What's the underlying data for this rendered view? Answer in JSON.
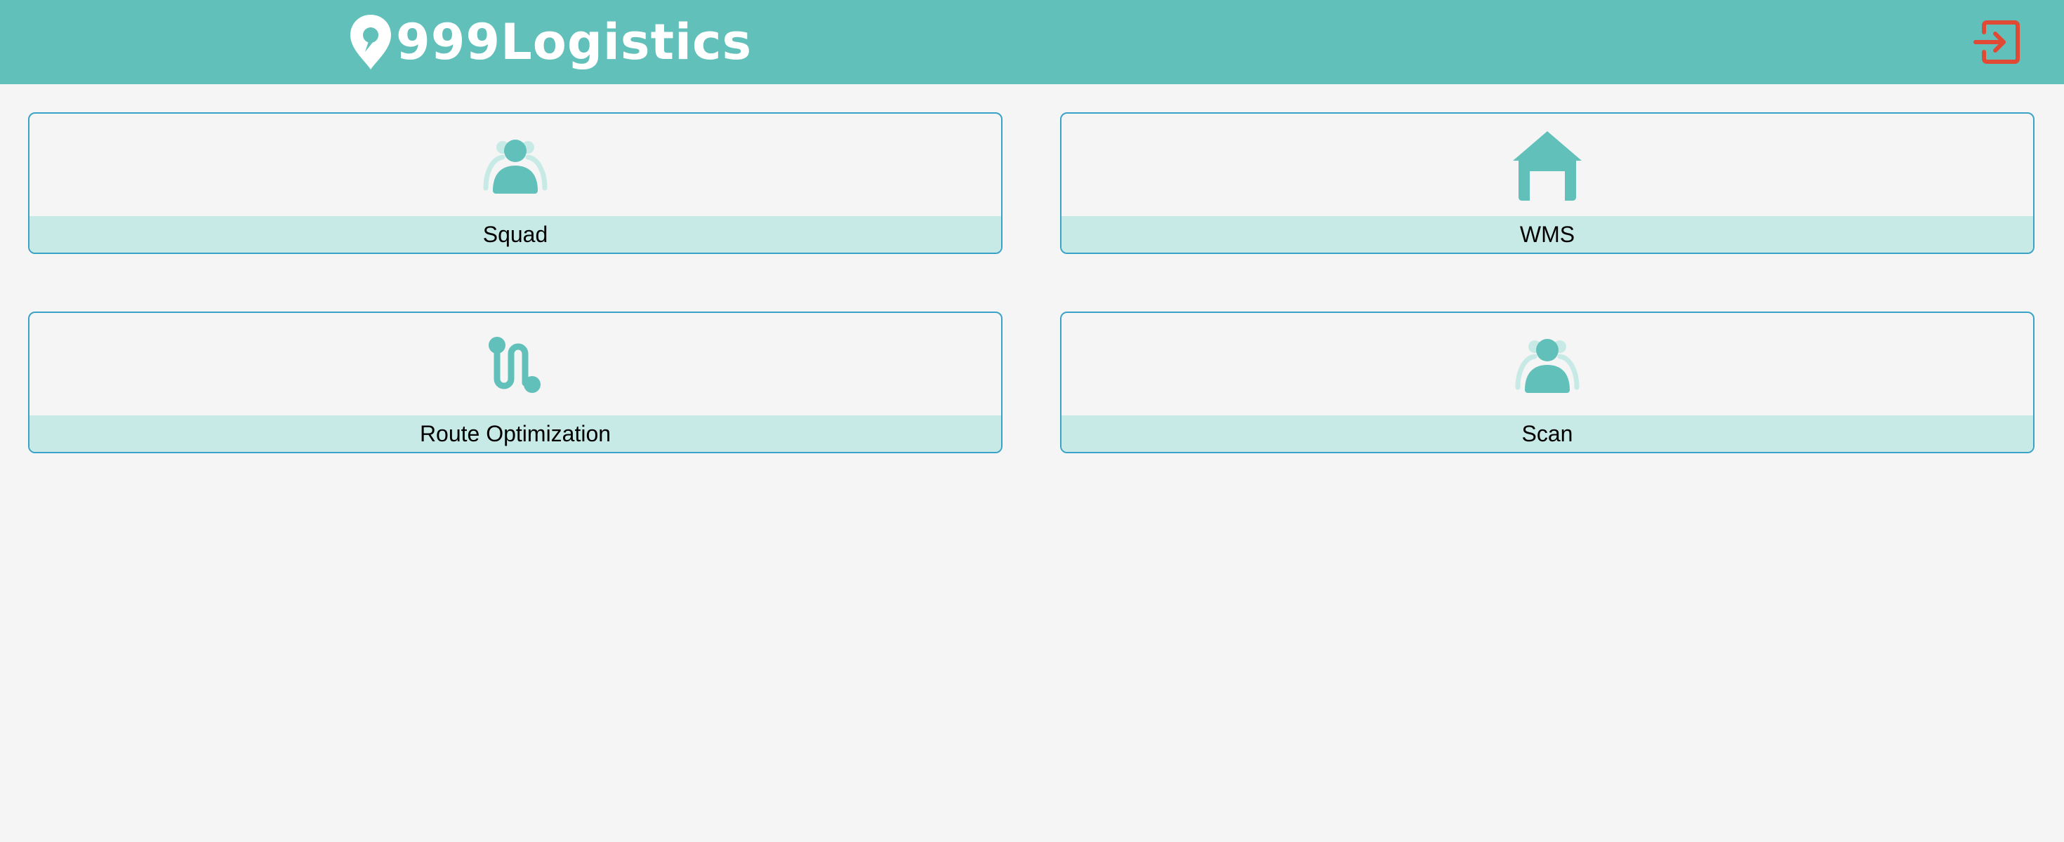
{
  "header": {
    "logo_text": "999Logistics",
    "background_color": "#61c0b9",
    "logout_icon": "logout-icon",
    "logout_color": "#e04a34"
  },
  "tiles": [
    {
      "label": "Squad",
      "icon": "users-icon"
    },
    {
      "label": "WMS",
      "icon": "warehouse-icon"
    },
    {
      "label": "Route Optimization",
      "icon": "route-icon"
    },
    {
      "label": "Scan",
      "icon": "users-icon"
    }
  ],
  "colors": {
    "accent": "#61c0b9",
    "tile_border": "#3aa2c6",
    "tile_label_bg": "#c8eae7",
    "page_bg": "#f5f5f5"
  }
}
